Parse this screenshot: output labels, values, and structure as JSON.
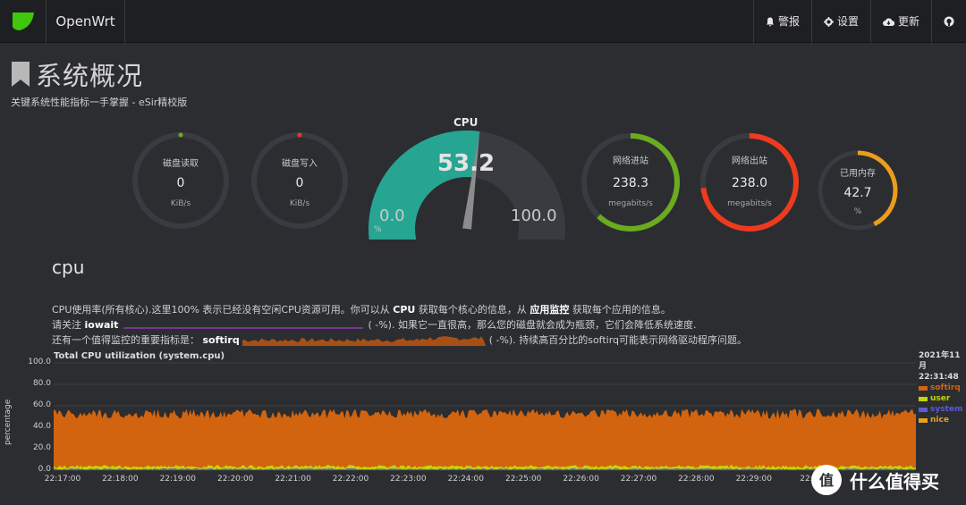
{
  "topbar": {
    "brand": "OpenWrt",
    "actions": [
      {
        "label": "警报",
        "icon": "bell-icon"
      },
      {
        "label": "设置",
        "icon": "gear-icon"
      },
      {
        "label": "更新",
        "icon": "cloud-download-icon"
      },
      {
        "label": "",
        "icon": "github-icon"
      }
    ]
  },
  "header": {
    "title": "系统概况",
    "subtitle": "关键系统性能指标一手掌握 - eSir精校版"
  },
  "gauges": {
    "disk_read": {
      "label": "磁盘读取",
      "value": "0",
      "unit": "KiB/s",
      "fraction": 0,
      "color": "#6aab1f"
    },
    "disk_write": {
      "label": "磁盘写入",
      "value": "0",
      "unit": "KiB/s",
      "fraction": 0,
      "color": "#e03b24"
    },
    "cpu": {
      "title": "CPU",
      "value": "53.2",
      "min": "0.0",
      "max": "100.0",
      "unit": "%",
      "fraction": 0.532,
      "color": "#26a593"
    },
    "net_in": {
      "label": "网络进站",
      "value": "238.3",
      "unit": "megabits/s",
      "fraction": 0.62,
      "color": "#6aab1f"
    },
    "net_out": {
      "label": "网络出站",
      "value": "238.0",
      "unit": "megabits/s",
      "fraction": 0.73,
      "color": "#ef3a1d"
    },
    "memory": {
      "label": "已用内存",
      "value": "42.7",
      "unit": "%",
      "fraction": 0.427,
      "color": "#eb9d1d"
    }
  },
  "section": {
    "title": "cpu",
    "line1_a": "CPU使用率(所有核心).这里100% 表示已经没有空闲CPU资源可用。你可以从 ",
    "line1_b": "CPU",
    "line1_c": " 获取每个核心的信息，从 ",
    "line1_d": "应用监控",
    "line1_e": " 获取每个应用的信息。",
    "line2_a": "请关注 ",
    "line2_b": "iowait",
    "line2_c": "(          -%). 如果它一直很高，那么您的磁盘就会成为瓶颈，它们会降低系统速度.",
    "line3_a": "还有一个值得监控的重要指标是： ",
    "line3_b": "softirq",
    "line3_c": "(          -%). 持续高百分比的softirq可能表示网络驱动程序问题。"
  },
  "chart_data": {
    "type": "area",
    "title": "Total CPU utilization (system.cpu)",
    "ylabel": "percentage",
    "date": "2021年11月",
    "time": "22:31:48",
    "ylim": [
      0,
      100
    ],
    "y_ticks": [
      "100.0",
      "80.0",
      "60.0",
      "40.0",
      "20.0",
      "0.0"
    ],
    "x_ticks": [
      "22:17:00",
      "22:18:00",
      "22:19:00",
      "22:20:00",
      "22:21:00",
      "22:22:00",
      "22:23:00",
      "22:24:00",
      "22:25:00",
      "22:26:00",
      "22:27:00",
      "22:28:00",
      "22:29:00",
      "22:30"
    ],
    "series": [
      {
        "name": "softirq",
        "color": "#d2640f",
        "approx_level": 50
      },
      {
        "name": "user",
        "color": "#c4d600",
        "approx_level": 2
      },
      {
        "name": "system",
        "color": "#5b5bd6",
        "approx_level": 1
      },
      {
        "name": "nice",
        "color": "#e6a21c",
        "approx_level": 0
      }
    ]
  },
  "watermark": {
    "text": "什么值得买",
    "badge": "值"
  }
}
